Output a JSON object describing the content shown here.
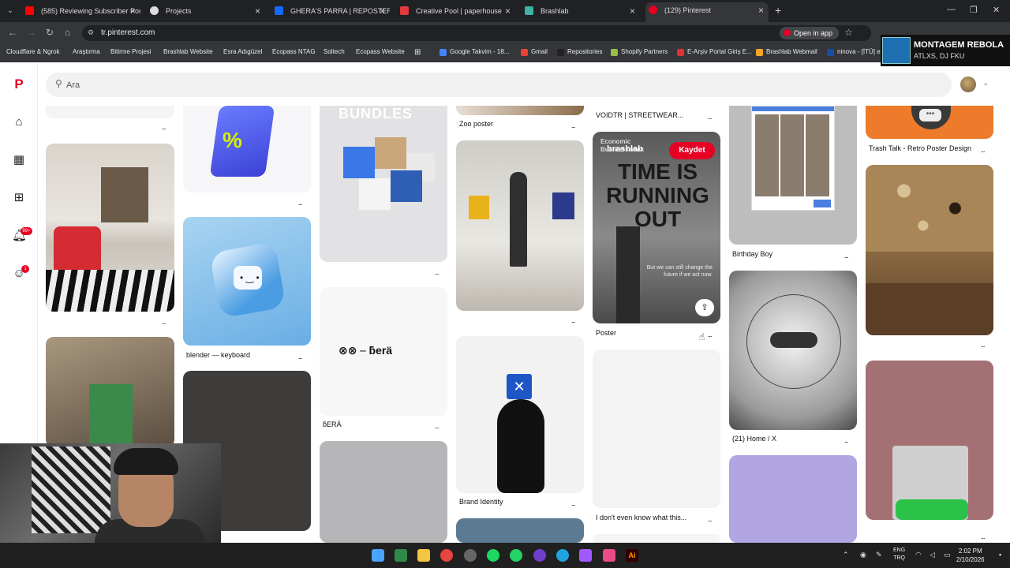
{
  "browser": {
    "tabs": [
      {
        "title": "(585) Reviewing Subscriber Por",
        "color": "#ff0000"
      },
      {
        "title": "Projects",
        "color": "#dddddd"
      },
      {
        "title": "GHERA'S PARRA | REPOSTERIA",
        "color": "#1769ff"
      },
      {
        "title": "Creative Pool | paperhouse",
        "color": "#e33b3b"
      },
      {
        "title": "Brashlab",
        "color": "#3fb3a4"
      },
      {
        "title": "(129) Pinterest",
        "color": "#e60023"
      }
    ],
    "url": "tr.pinterest.com",
    "open_in_app": "Open in app",
    "bookmarks": [
      {
        "label": "Cloudflare & Ngrok"
      },
      {
        "label": "Araştırma"
      },
      {
        "label": "Bitirme Projesi"
      },
      {
        "label": "Brashlab Website"
      },
      {
        "label": "Esra Adıgüzel"
      },
      {
        "label": "Ecopass NTAG"
      },
      {
        "label": "Soltech"
      },
      {
        "label": "Ecopass Website"
      },
      {
        "label": "Google Takvim - 18..."
      },
      {
        "label": "Gmail"
      },
      {
        "label": "Repositories"
      },
      {
        "label": "Shopify Partners"
      },
      {
        "label": "E-Arşiv Portal Giriş E..."
      },
      {
        "label": "Brashlab Webmail"
      },
      {
        "label": "ninova - [İTÜ] e-O"
      }
    ]
  },
  "media_overlay": {
    "title": "MONTAGEM REBOLA",
    "artist": "ATLXS, DJ FKU"
  },
  "pinterest": {
    "search_placeholder": "Ara",
    "notification_badge": "99+",
    "message_badge": "1",
    "save_button": "Kaydet",
    "pin_text": {
      "bundles": "BUNDLES",
      "bera_logo": "ƃerä",
      "brashlab_overlay": "brashlab",
      "poster_headline_1": "TIME IS",
      "poster_headline_2": "RUNNING",
      "poster_headline_3": "OUT",
      "poster_sub": "But we can still change the future if we act now.",
      "poster_brand": "Economic Businessweek"
    },
    "titles": {
      "keyboard": "blender — keyboard",
      "bera": "ƃERÄ",
      "zoo": "Zoo poster",
      "brand": "Brand Identity",
      "voidtr": "VOIDTR | STREETWEAR...",
      "poster": "Poster",
      "idk": "I don't even know what this...",
      "birthday": "Birthday Boy",
      "home_x": "(21) Home / X",
      "trash": "Trash Talk - Retro Poster Design"
    },
    "more": "..."
  },
  "taskbar": {
    "lang_1": "ENG",
    "lang_2": "TRQ",
    "time": "2:02 PM",
    "date": "2/10/2026"
  }
}
